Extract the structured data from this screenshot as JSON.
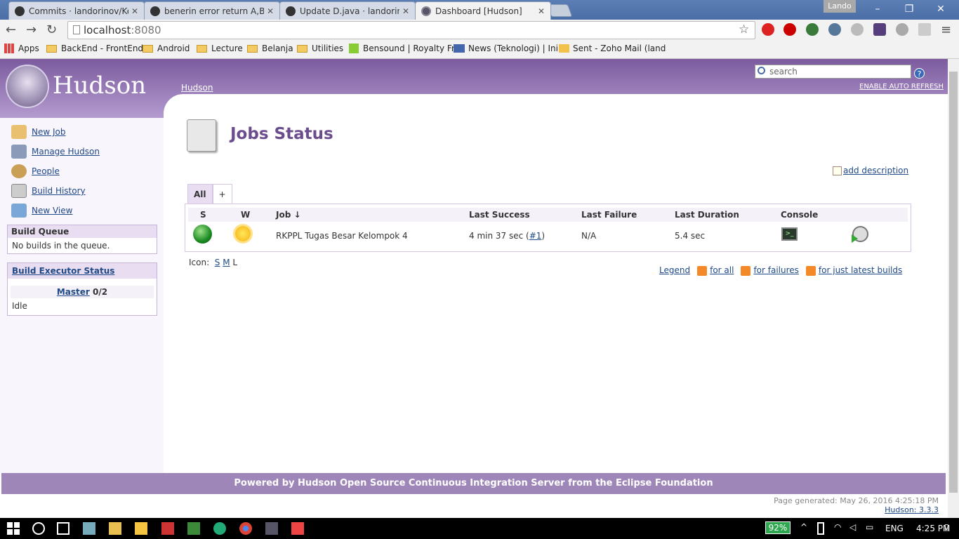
{
  "browser": {
    "tabs": [
      {
        "title": "Commits · landorinov/Kel…"
      },
      {
        "title": "benerin error return A,B,D"
      },
      {
        "title": "Update D.java · landorinov"
      },
      {
        "title": "Dashboard [Hudson]"
      }
    ],
    "user": "Lando",
    "url_host": "localhost",
    "url_port": ":8080",
    "bookmarks": [
      "Apps",
      "BackEnd - FrontEnd",
      "Android",
      "Lecture",
      "Belanja",
      "Utilities",
      "Bensound | Royalty Fr",
      "News (Teknologi) | Ini",
      "Sent - Zoho Mail (land"
    ]
  },
  "header": {
    "logo": "Hudson",
    "breadcrumb": "Hudson",
    "search_placeholder": "search",
    "help": "?",
    "auto_refresh": "ENABLE AUTO REFRESH"
  },
  "sidebar": {
    "tasks": [
      "New Job",
      "Manage Hudson",
      "People",
      "Build History",
      "New View"
    ],
    "queue_title": "Build Queue",
    "queue_text": "No builds in the queue.",
    "executor_title": "Build Executor Status",
    "master_label": "Master",
    "master_count": "0/2",
    "idle": "Idle"
  },
  "main": {
    "title": "Jobs Status",
    "add_description": "add description",
    "view_tabs": [
      "All",
      "+"
    ],
    "columns": [
      "S",
      "W",
      "Job ↓",
      "Last Success",
      "Last Failure",
      "Last Duration",
      "Console"
    ],
    "job": {
      "name": "RKPPL Tugas Besar Kelompok 4",
      "last_success": "4 min 37 sec (",
      "build_link": "#1",
      "last_success_close": ")",
      "last_failure": "N/A",
      "last_duration": "5.4 sec",
      "status_color": "#1a8a22",
      "weather": "sunny"
    },
    "icon_label": "Icon:",
    "icon_sizes": [
      "S",
      "M",
      "L"
    ],
    "legend": "Legend",
    "rss_all": "for all",
    "rss_failures": "for failures",
    "rss_latest": "for just latest builds"
  },
  "footer": {
    "powered": "Powered by Hudson Open Source Continuous Integration Server from the Eclipse Foundation",
    "generated": "Page generated: May 26, 2016 4:25:18 PM",
    "version": "Hudson: 3.3.3"
  },
  "taskbar": {
    "battery": "92%",
    "lang": "ENG",
    "time": "4:25 PM"
  }
}
